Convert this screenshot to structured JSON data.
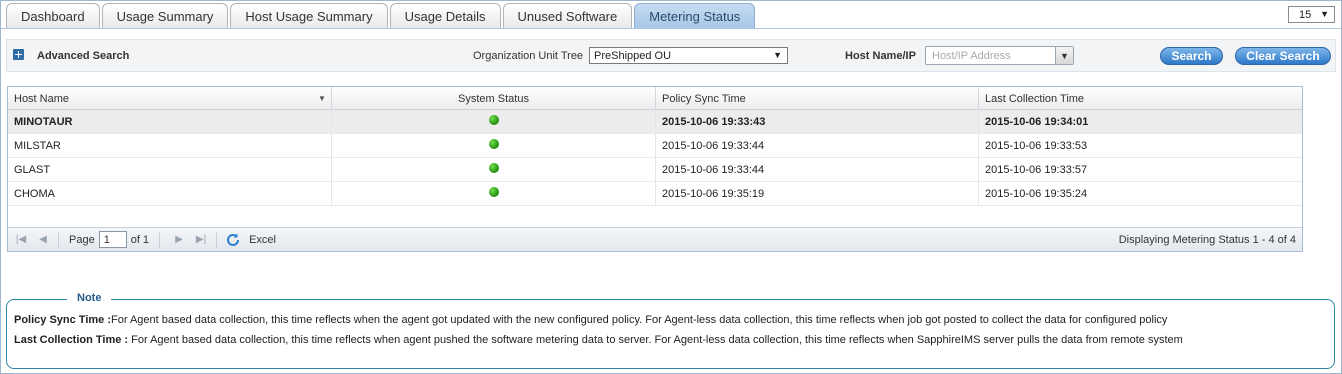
{
  "tabs": [
    {
      "label": "Dashboard",
      "active": false
    },
    {
      "label": "Usage Summary",
      "active": false
    },
    {
      "label": "Host Usage Summary",
      "active": false
    },
    {
      "label": "Usage Details",
      "active": false
    },
    {
      "label": "Unused Software",
      "active": false
    },
    {
      "label": "Metering Status",
      "active": true
    }
  ],
  "page_size": {
    "value": "15"
  },
  "search": {
    "advanced_label": "Advanced Search",
    "ou_label": "Organization Unit Tree",
    "ou_value": "PreShipped OU",
    "host_label": "Host Name/IP",
    "host_placeholder": "Host/IP Address",
    "search_button": "Search",
    "clear_button": "Clear Search"
  },
  "grid": {
    "columns": [
      "Host Name",
      "System Status",
      "Policy Sync Time",
      "Last Collection Time"
    ],
    "rows": [
      {
        "host": "MINOTAUR",
        "status": "online",
        "policy_sync": "2015-10-06 19:33:43",
        "last_collection": "2015-10-06 19:34:01"
      },
      {
        "host": "MILSTAR",
        "status": "online",
        "policy_sync": "2015-10-06 19:33:44",
        "last_collection": "2015-10-06 19:33:53"
      },
      {
        "host": "GLAST",
        "status": "online",
        "policy_sync": "2015-10-06 19:33:44",
        "last_collection": "2015-10-06 19:33:57"
      },
      {
        "host": "CHOMA",
        "status": "online",
        "policy_sync": "2015-10-06 19:35:19",
        "last_collection": "2015-10-06 19:35:24"
      }
    ],
    "status_color": "#1e8c0c"
  },
  "pager": {
    "page_label": "Page",
    "page_value": "1",
    "of_label": "of 1",
    "excel_label": "Excel",
    "display_text": "Displaying Metering Status 1 - 4 of 4"
  },
  "note": {
    "title": "Note",
    "line1_label": "Policy Sync Time :",
    "line1_text": "For Agent based data collection, this time reflects when the agent got updated with the new configured policy. For Agent-less data collection, this time reflects when job got posted to collect the data for configured policy",
    "line2_label": "Last Collection Time :",
    "line2_text": " For Agent based data collection, this time reflects when agent pushed the software metering data to server. For Agent-less data collection, this time reflects when SapphireIMS server pulls the data from remote system"
  }
}
